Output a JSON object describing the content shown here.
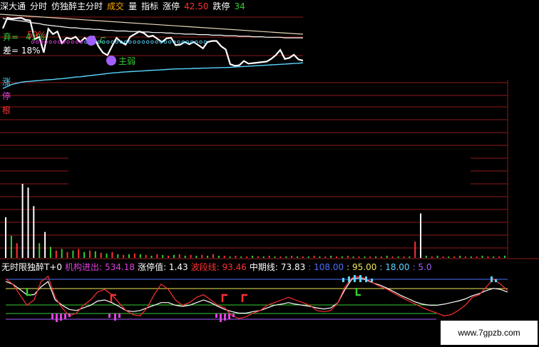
{
  "colors": {
    "background": "#000000",
    "grid_red": "#8e1a1a",
    "white": "#ffffff",
    "cyan": "#5ad6ff",
    "green": "#33cc33",
    "magenta": "#e040e0",
    "red": "#ff3030",
    "yellow": "#f2e85a",
    "blue": "#5070ff",
    "orange": "#ffa040",
    "purple": "#9f60ff",
    "beige": "#e8d8b8"
  },
  "header": {
    "items": [
      {
        "text": "深大通",
        "color": "#ffffff"
      },
      {
        "text": "分时",
        "color": "#ffffff"
      },
      {
        "text": "仿独醉主分时",
        "color": "#ffffff"
      },
      {
        "text": "成交",
        "color": "#ffaa00"
      },
      {
        "text": "量",
        "color": "#ffffff"
      },
      {
        "text": "指标",
        "color": "#ffffff"
      },
      {
        "text": "涨停",
        "color": "#ffffff"
      },
      {
        "text": "42.50",
        "color": "#ff3030"
      },
      {
        "text": "跌停",
        "color": "#ffffff"
      },
      {
        "text": "34",
        "color": "#33cc33"
      }
    ]
  },
  "top_labels": {
    "pct1": "59%",
    "pct2_prefix": "弃=",
    "pct2": "41%",
    "pct3": "差= 18%",
    "tag_strong": "C",
    "tag_weak": "主弱"
  },
  "side_labels": {
    "zhang": "涨",
    "ting": "停",
    "gen": "根"
  },
  "indicator_line": {
    "items": [
      {
        "text": "无时限独醉T+0",
        "color": "#ffffff"
      },
      {
        "text": "机构进出:",
        "color": "#e040e0"
      },
      {
        "text": "534.18",
        "color": "#e040e0"
      },
      {
        "text": "涨停值: 1.43",
        "color": "#ffffff"
      },
      {
        "text": "波段线: 93.46",
        "color": "#ff3030"
      },
      {
        "text": "中期线:",
        "color": "#ffffff"
      },
      {
        "text": "73.83",
        "color": "#ffffff"
      },
      {
        "text": ": 108.00",
        "color": "#5070ff"
      },
      {
        "text": ": 95.00",
        "color": "#f2e85a"
      },
      {
        "text": ": 18.00",
        "color": "#5ad6ff"
      },
      {
        "text": ": 5.0",
        "color": "#9f60ff"
      }
    ]
  },
  "watermark": "www.7gpzb.com",
  "chart_data": {
    "type": "line",
    "price_line": [
      0.76,
      0.96,
      0.94,
      0.95,
      0.96,
      0.92,
      0.91,
      0.55,
      0.6,
      0.3,
      0.75,
      0.65,
      0.7,
      0.48,
      0.58,
      0.56,
      0.6,
      0.5,
      0.58,
      0.52,
      0.6,
      0.42,
      0.3,
      0.25,
      0.42,
      0.58,
      0.5,
      0.45,
      0.6,
      0.65,
      0.7,
      0.67,
      0.6,
      0.62,
      0.56,
      0.5,
      0.57,
      0.58,
      0.44,
      0.45,
      0.5,
      0.46,
      0.5,
      0.44,
      0.38,
      0.5,
      0.52,
      0.52,
      0.42,
      0.36,
      0.08,
      0.05,
      0.06,
      0.14,
      0.09,
      0.1,
      0.11,
      0.12,
      0.13,
      0.18,
      0.25,
      0.35,
      0.18,
      0.2,
      0.26,
      0.17,
      0.15
    ],
    "avg_line": [
      0.95,
      0.93,
      0.92,
      0.91,
      0.9,
      0.89,
      0.87,
      0.86,
      0.85,
      0.83,
      0.82,
      0.81,
      0.8,
      0.79,
      0.78,
      0.77,
      0.77,
      0.76,
      0.75,
      0.75,
      0.74,
      0.74,
      0.73,
      0.72,
      0.72,
      0.71,
      0.71,
      0.71,
      0.7,
      0.7,
      0.7,
      0.69,
      0.69,
      0.68,
      0.68,
      0.68,
      0.67,
      0.67,
      0.66,
      0.66,
      0.65,
      0.65,
      0.65,
      0.64,
      0.64,
      0.64,
      0.63,
      0.63,
      0.63,
      0.62,
      0.62,
      0.62,
      0.61,
      0.61,
      0.61,
      0.6,
      0.6,
      0.6,
      0.59,
      0.59,
      0.59,
      0.59,
      0.58,
      0.58,
      0.58,
      0.58,
      0.58
    ],
    "cyan_line": [
      0.05,
      0.12,
      0.2,
      0.24,
      0.28,
      0.3,
      0.31,
      0.33,
      0.34,
      0.36,
      0.37,
      0.38,
      0.4,
      0.41,
      0.43,
      0.45,
      0.47,
      0.48,
      0.5,
      0.52,
      0.54,
      0.56,
      0.58,
      0.6,
      0.62,
      0.63,
      0.65,
      0.66,
      0.67,
      0.68,
      0.69,
      0.7,
      0.71,
      0.72,
      0.73,
      0.74,
      0.75,
      0.76,
      0.77,
      0.77,
      0.78,
      0.78,
      0.79,
      0.79,
      0.8,
      0.8,
      0.81,
      0.81,
      0.82,
      0.82,
      0.83,
      0.84,
      0.85,
      0.86,
      0.87,
      0.88,
      0.89,
      0.9,
      0.91,
      0.92,
      0.93,
      0.94,
      0.95,
      0.96,
      0.97,
      0.98,
      1.0
    ],
    "volume": [
      0.55,
      0.3,
      0.2,
      1.0,
      0.95,
      0.7,
      0.2,
      0.35,
      0.15,
      0.1,
      0.12,
      0.08,
      0.1,
      0.12,
      0.08,
      0.1,
      0.09,
      0.07,
      0.06,
      0.08,
      0.05,
      0.04,
      0.05,
      0.06,
      0.05,
      0.04,
      0.03,
      0.05,
      0.04,
      0.03,
      0.04,
      0.05,
      0.03,
      0.04,
      0.03,
      0.04,
      0.03,
      0.05,
      0.03,
      0.03,
      0.02,
      0.03,
      0.02,
      0.02,
      0.03,
      0.02,
      0.02,
      0.03,
      0.02,
      0.02,
      0.02,
      0.03,
      0.02,
      0.02,
      0.02,
      0.03,
      0.02,
      0.02,
      0.03,
      0.02,
      0.02,
      0.03,
      0.02,
      0.02,
      0.02,
      0.02,
      0.02,
      0.02,
      0.03,
      0.02,
      0.02,
      0.02,
      0.02,
      0.22,
      0.6,
      0.03,
      0.02,
      0.03,
      0.02,
      0.02,
      0.02,
      0.03,
      0.02,
      0.02,
      0.02,
      0.03,
      0.02,
      0.02,
      0.02,
      0.03
    ],
    "volume_color": [
      "w",
      "g",
      "r",
      "w",
      "w",
      "w",
      "g",
      "w",
      "g",
      "r",
      "g",
      "r",
      "g",
      "r",
      "g",
      "r",
      "g",
      "r",
      "g",
      "r",
      "g",
      "r",
      "g",
      "r",
      "g",
      "r",
      "g",
      "r",
      "g",
      "r",
      "g",
      "r",
      "g",
      "r",
      "g",
      "r",
      "g",
      "r",
      "g",
      "r",
      "g",
      "r",
      "g",
      "r",
      "g",
      "r",
      "g",
      "r",
      "g",
      "r",
      "g",
      "r",
      "g",
      "r",
      "g",
      "r",
      "g",
      "r",
      "g",
      "r",
      "g",
      "r",
      "g",
      "r",
      "g",
      "r",
      "g",
      "r",
      "g",
      "r",
      "g",
      "r",
      "g",
      "r",
      "w",
      "g",
      "r",
      "g",
      "r",
      "g",
      "r",
      "g",
      "r",
      "g",
      "r",
      "g",
      "r",
      "g",
      "r",
      "g"
    ],
    "ind_red": [
      0.9,
      0.8,
      0.6,
      0.4,
      0.5,
      0.85,
      0.95,
      0.55,
      0.35,
      0.2,
      0.25,
      0.4,
      0.5,
      0.65,
      0.7,
      0.6,
      0.45,
      0.3,
      0.22,
      0.2,
      0.35,
      0.6,
      0.8,
      0.7,
      0.5,
      0.4,
      0.45,
      0.55,
      0.6,
      0.5,
      0.4,
      0.35,
      0.2,
      0.15,
      0.18,
      0.25,
      0.3,
      0.4,
      0.45,
      0.5,
      0.55,
      0.5,
      0.45,
      0.4,
      0.3,
      0.28,
      0.3,
      0.45,
      0.75,
      0.92,
      0.95,
      0.9,
      0.82,
      0.75,
      0.7,
      0.62,
      0.55,
      0.48,
      0.42,
      0.35,
      0.3,
      0.25,
      0.2,
      0.22,
      0.3,
      0.4,
      0.55,
      0.6,
      0.75,
      0.9,
      0.8,
      0.68
    ],
    "ind_white": [
      0.85,
      0.8,
      0.7,
      0.6,
      0.6,
      0.75,
      0.85,
      0.5,
      0.4,
      0.32,
      0.3,
      0.35,
      0.4,
      0.48,
      0.5,
      0.45,
      0.38,
      0.3,
      0.28,
      0.3,
      0.35,
      0.4,
      0.45,
      0.45,
      0.4,
      0.38,
      0.4,
      0.45,
      0.5,
      0.45,
      0.38,
      0.32,
      0.28,
      0.25,
      0.25,
      0.28,
      0.3,
      0.35,
      0.4,
      0.42,
      0.45,
      0.42,
      0.4,
      0.38,
      0.35,
      0.33,
      0.35,
      0.45,
      0.7,
      0.9,
      0.92,
      0.88,
      0.82,
      0.78,
      0.72,
      0.65,
      0.58,
      0.52,
      0.46,
      0.42,
      0.4,
      0.4,
      0.42,
      0.45,
      0.48,
      0.52,
      0.58,
      0.62,
      0.68,
      0.72,
      0.7,
      0.65
    ]
  }
}
